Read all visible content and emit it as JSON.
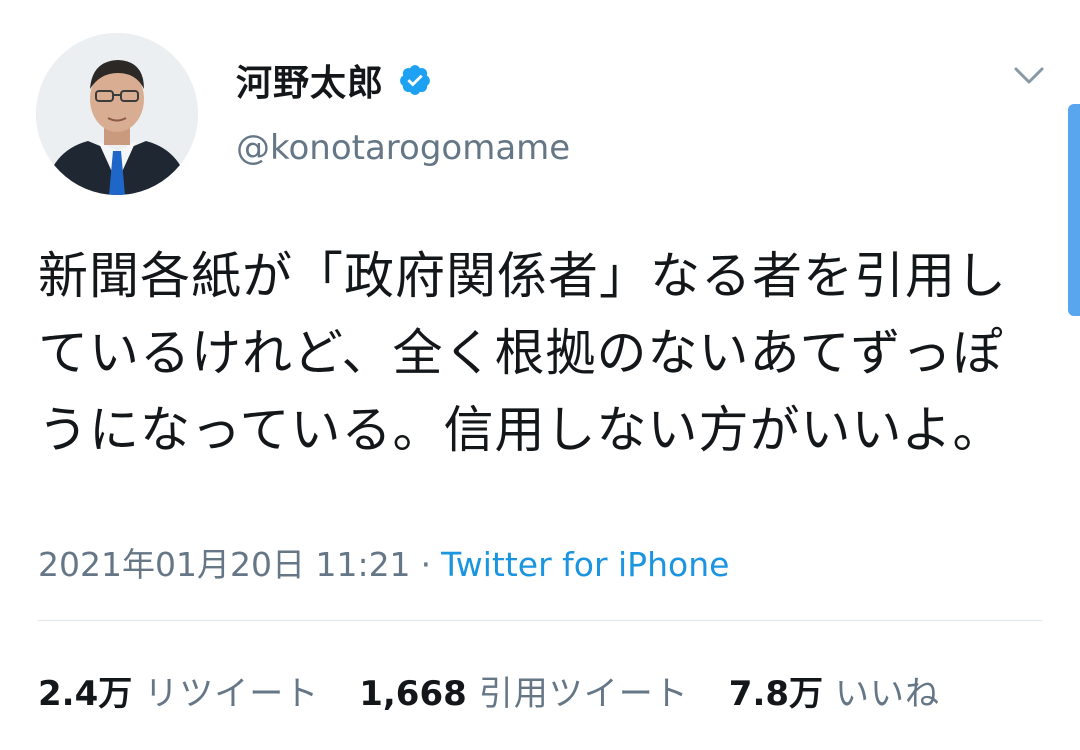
{
  "author": {
    "display_name": "河野太郎",
    "handle": "@konotarogomame",
    "verified": true,
    "avatar_icon": "profile-photo"
  },
  "tweet": {
    "text": "新聞各紙が「政府関係者」なる者を引用しているけれど、全く根拠のないあてずっぽうになっている。信用しない方がいいよ。",
    "timestamp": "2021年01月20日 11:21",
    "separator": "·",
    "source": "Twitter for iPhone"
  },
  "stats": {
    "retweets": {
      "value": "2.4万",
      "label": "リツイート"
    },
    "quotes": {
      "value": "1,668",
      "label": "引用ツイート"
    },
    "likes": {
      "value": "7.8万",
      "label": "いいね"
    }
  },
  "colors": {
    "accent": "#1b95e0",
    "verified": "#1da1f2",
    "secondary_text": "#657786",
    "primary_text": "#14171a",
    "divider": "#e1e8ed"
  }
}
